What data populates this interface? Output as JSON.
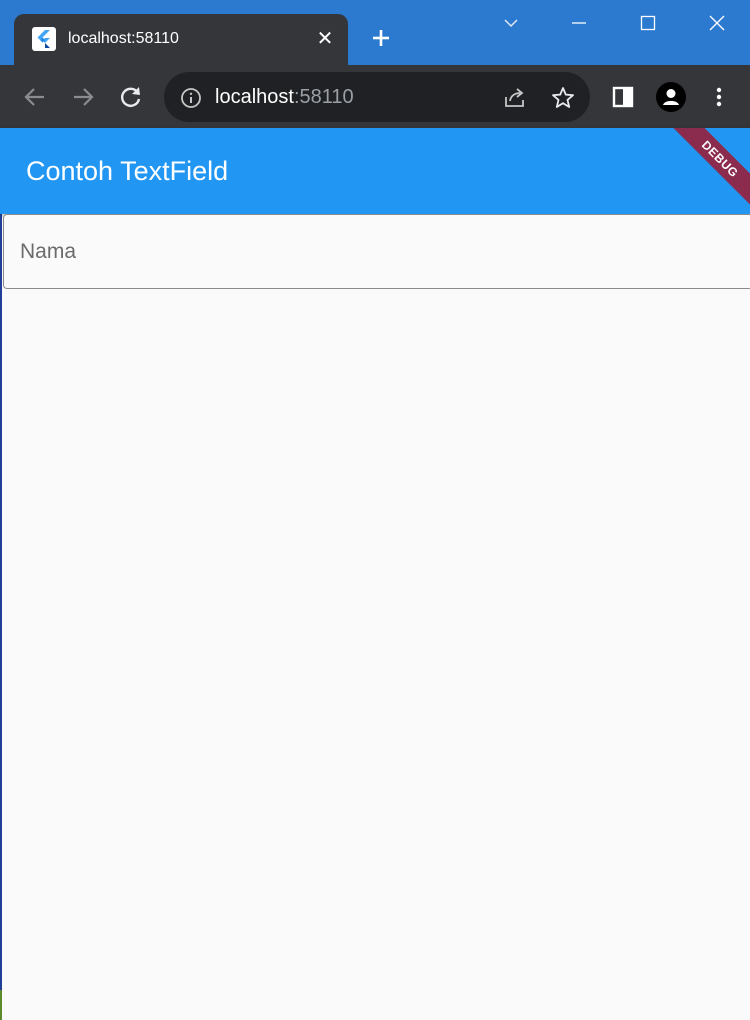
{
  "browser": {
    "tab": {
      "title": "localhost:58110",
      "favicon_icon": "flutter-icon"
    },
    "address_bar": {
      "host": "localhost",
      "port": ":58110"
    },
    "icons": {
      "back": "arrow-left-icon",
      "forward": "arrow-right-icon",
      "reload": "reload-icon",
      "info": "info-icon",
      "share": "share-icon",
      "bookmark": "star-icon",
      "side_panel": "side-panel-icon",
      "profile": "profile-icon",
      "menu": "kebab-menu-icon",
      "new_tab": "plus-icon",
      "tab_close": "close-icon",
      "tab_search": "chevron-down-icon",
      "minimize": "minimize-icon",
      "maximize": "maximize-icon",
      "window_close": "close-icon"
    }
  },
  "app": {
    "appbar_title": "Contoh TextField",
    "debug_banner": "DEBUG",
    "textfield": {
      "placeholder": "Nama",
      "value": ""
    },
    "colors": {
      "appbar": "#2196f3",
      "background": "#fafafa",
      "debug_banner": "#8b2b4e"
    }
  }
}
